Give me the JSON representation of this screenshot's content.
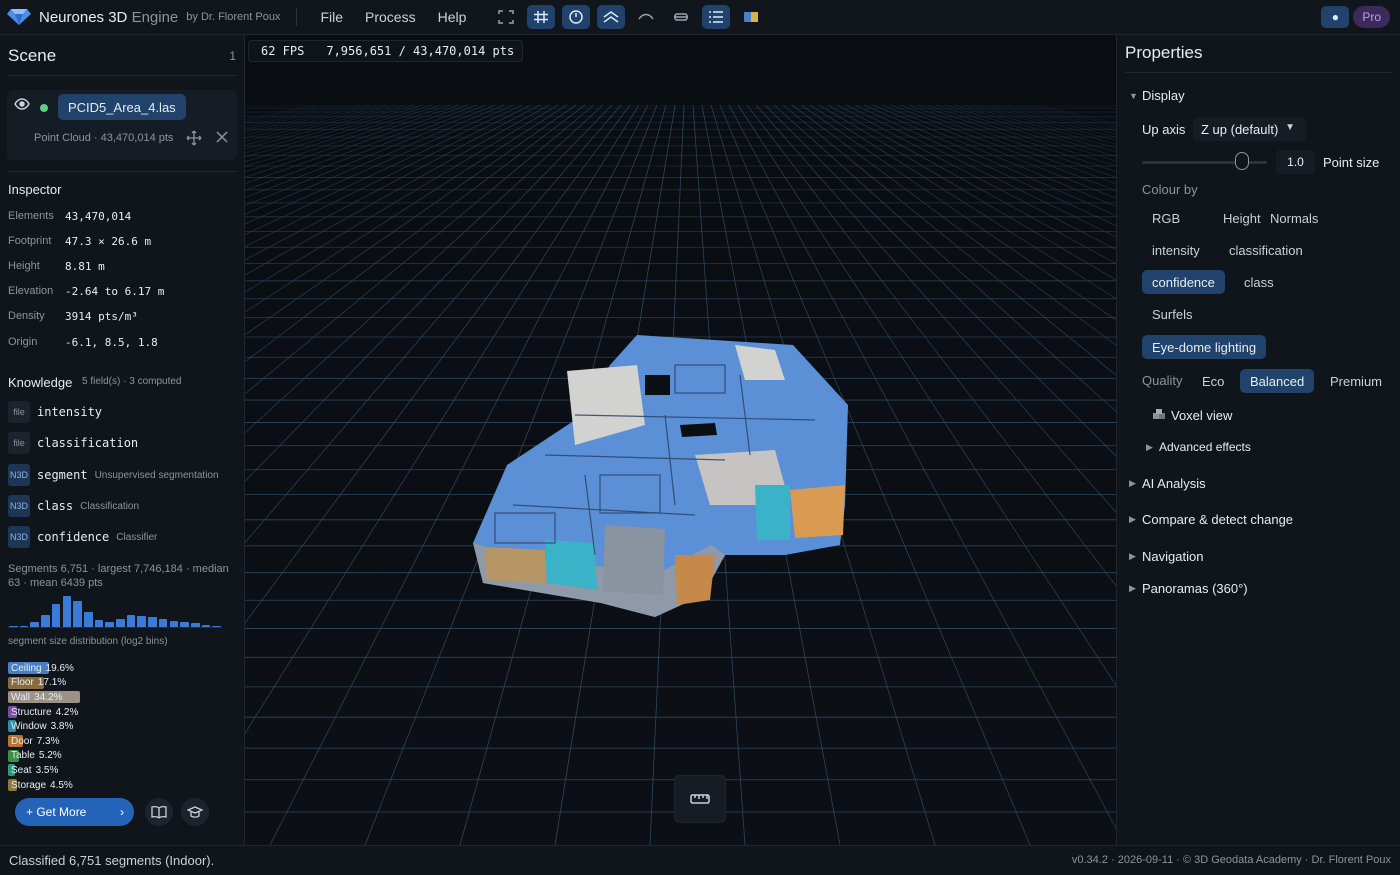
{
  "app": {
    "title_main": "Neurones 3D",
    "title_light": "Engine",
    "byline": "by Dr. Florent Poux"
  },
  "menu": [
    "File",
    "Process",
    "Help"
  ],
  "toolbar_icons": [
    "fullscreen-icon",
    "grid-icon",
    "orbit-icon",
    "layers-icon",
    "curve-icon",
    "section-icon",
    "list-icon",
    "palette-icon"
  ],
  "topright": {
    "pro_label": "Pro"
  },
  "scene": {
    "title": "Scene",
    "count": "1",
    "file_name": "PCID5_Area_4.las",
    "file_sub": "Point Cloud · 43,470,014 pts"
  },
  "inspector": {
    "title": "Inspector",
    "rows": [
      {
        "key": "Elements",
        "value": "43,470,014"
      },
      {
        "key": "Footprint",
        "value": "47.3 × 26.6 m"
      },
      {
        "key": "Height",
        "value": "8.81 m"
      },
      {
        "key": "Elevation",
        "value": "-2.64 to 6.17 m"
      },
      {
        "key": "Density",
        "value": "3914 pts/m³"
      },
      {
        "key": "Origin",
        "value": "-6.1, 8.5, 1.8"
      }
    ]
  },
  "knowledge": {
    "title": "Knowledge",
    "subtitle": "5 field(s) · 3 computed",
    "fields": [
      {
        "badge": "file",
        "name": "intensity",
        "desc": ""
      },
      {
        "badge": "file",
        "name": "classification",
        "desc": ""
      },
      {
        "badge": "N3D",
        "name": "segment",
        "desc": "Unsupervised segmentation"
      },
      {
        "badge": "N3D",
        "name": "class",
        "desc": "Classification"
      },
      {
        "badge": "N3D",
        "name": "confidence",
        "desc": "Classifier"
      }
    ],
    "segments_text": "Segments 6,751 · largest 7,746,184 · median 63 · mean 6439 pts",
    "histogram_label": "segment size distribution (log2 bins)",
    "histogram_values": [
      1,
      1,
      4,
      10,
      19,
      26,
      22,
      13,
      6,
      4,
      7,
      10,
      9,
      8,
      7,
      5,
      4,
      3,
      2,
      1
    ],
    "classes": [
      {
        "name": "Ceiling",
        "pct": "19.6%",
        "value": 19.6,
        "color": "#4a7fc4"
      },
      {
        "name": "Floor",
        "pct": "17.1%",
        "value": 17.1,
        "color": "#8a6a3c"
      },
      {
        "name": "Wall",
        "pct": "34.2%",
        "value": 34.2,
        "color": "#9b9388"
      },
      {
        "name": "Structure",
        "pct": "4.2%",
        "value": 4.2,
        "color": "#7a4fa0"
      },
      {
        "name": "Window",
        "pct": "3.8%",
        "value": 3.8,
        "color": "#2f8fa8"
      },
      {
        "name": "Door",
        "pct": "7.3%",
        "value": 7.3,
        "color": "#b8742e"
      },
      {
        "name": "Table",
        "pct": "5.2%",
        "value": 5.2,
        "color": "#3e8f4a"
      },
      {
        "name": "Seat",
        "pct": "3.5%",
        "value": 3.5,
        "color": "#2f9a7a"
      },
      {
        "name": "Storage",
        "pct": "4.5%",
        "value": 4.5,
        "color": "#8a7a3a"
      }
    ],
    "get_more_label": "Get More"
  },
  "viewport": {
    "fps": "62 FPS",
    "points": "7,956,651 / 43,470,014 pts"
  },
  "properties": {
    "title": "Properties",
    "display_label": "Display",
    "up_axis_label": "Up axis",
    "up_axis_value": "Z up (default)",
    "point_size_value": "1.0",
    "point_size_label": "Point size",
    "colour_by_label": "Colour by",
    "colour_options": [
      "RGB",
      "Height",
      "Normals",
      "intensity",
      "classification",
      "confidence",
      "class",
      "Surfels"
    ],
    "colour_selected": "confidence",
    "edl_label": "Eye-dome lighting",
    "quality_label": "Quality",
    "quality_options": [
      "Eco",
      "Balanced",
      "Premium"
    ],
    "quality_selected": "Balanced",
    "voxel_label": "Voxel view",
    "advanced_label": "Advanced effects",
    "sections": [
      "AI Analysis",
      "Compare & detect change",
      "Navigation",
      "Panoramas (360°)"
    ]
  },
  "status": {
    "left": "Classified 6,751 segments (Indoor).",
    "right": "v0.34.2 · 2026-09-11 · © 3D Geodata Academy · Dr. Florent Poux"
  },
  "colors": {
    "accent": "#2364b8",
    "active_chip": "#21426a",
    "grid": "#3c5a78",
    "pointcloud_main": "#5b8fd6"
  }
}
